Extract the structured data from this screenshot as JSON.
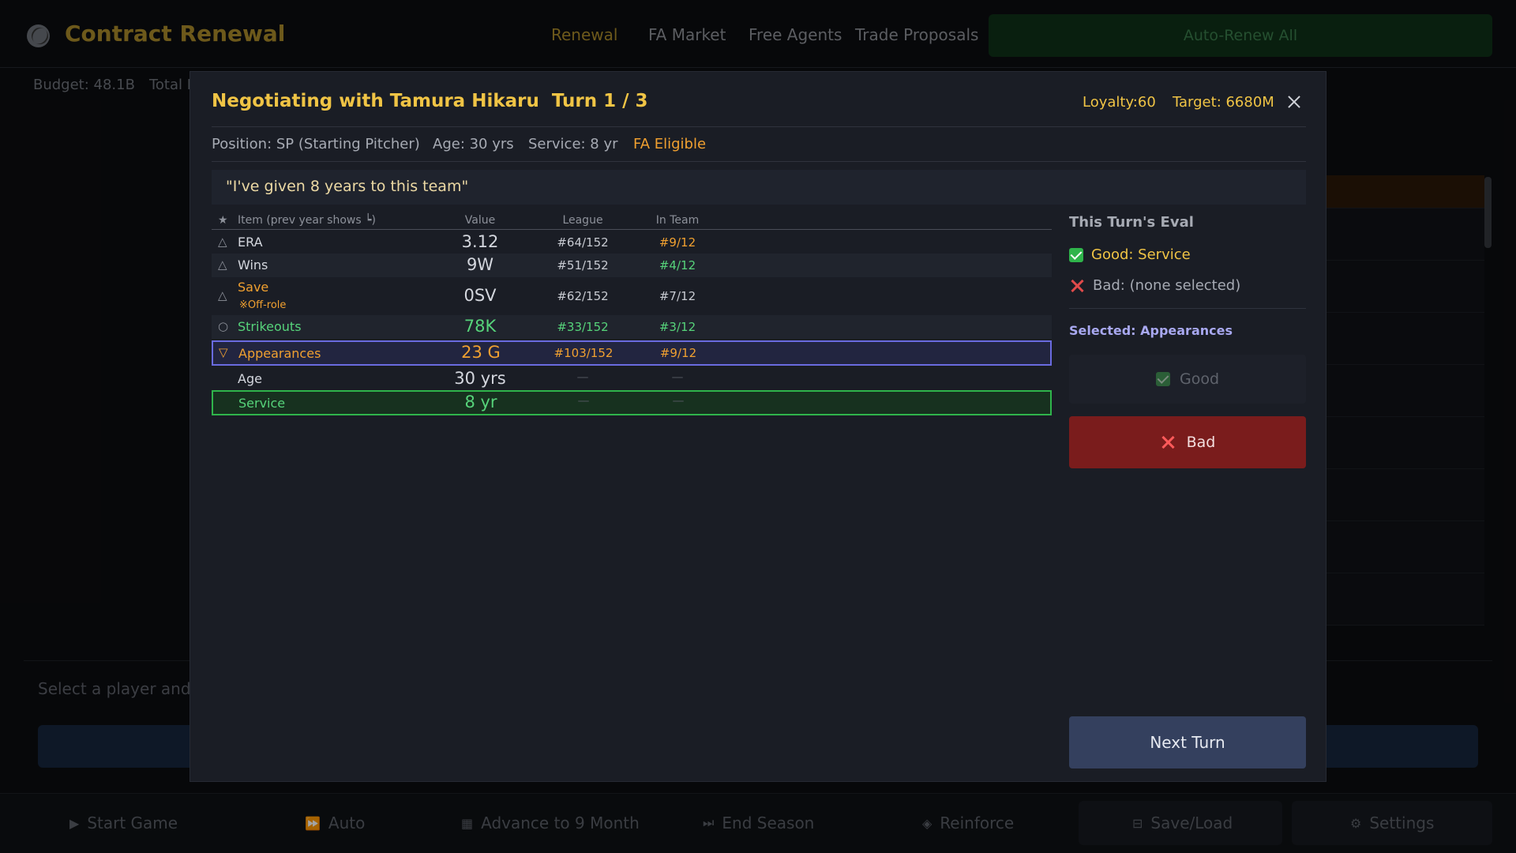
{
  "app": {
    "title": "Contract Renewal",
    "nav": [
      "Renewal",
      "FA Market",
      "Free Agents",
      "Trade Proposals"
    ],
    "auto_renew_label": "Auto-Renew All",
    "budget": "Budget: 48.1B",
    "total_label": "Total P",
    "hint": "Select a player and n",
    "bottom": {
      "start_game": "Start Game",
      "auto": "Auto",
      "advance": "Advance to 9 Month",
      "end_season": "End Season",
      "reinforce": "Reinforce",
      "save_load": "Save/Load",
      "settings": "Settings"
    }
  },
  "modal": {
    "title": "Negotiating with Tamura Hikaru  Turn 1 / 3",
    "loyalty": "Loyalty:60",
    "target": "Target: 6680M",
    "position": "Position: SP (Starting Pitcher)",
    "age": "Age: 30 yrs",
    "service": "Service: 8 yr",
    "fa_status": "FA Eligible",
    "quote": "\"I've given 8 years to this team\"",
    "table": {
      "headers": {
        "mark": "★",
        "item": "Item (prev year shows ┕)",
        "value": "Value",
        "league": "League",
        "team": "In Team"
      },
      "rows": [
        {
          "mark": "△",
          "name": "ERA",
          "value": "3.12",
          "league": "#64/152",
          "team": "#9/12"
        },
        {
          "mark": "△",
          "name": "Wins",
          "value": "9W",
          "league": "#51/152",
          "team": "#4/12"
        },
        {
          "mark": "△",
          "name": "Save",
          "sub": "※Off-role",
          "value": "0SV",
          "league": "#62/152",
          "team": "#7/12"
        },
        {
          "mark": "○",
          "name": "Strikeouts",
          "value": "78K",
          "league": "#33/152",
          "team": "#3/12"
        },
        {
          "mark": "▽",
          "name": "Appearances",
          "value": "23 G",
          "league": "#103/152",
          "team": "#9/12"
        },
        {
          "mark": "",
          "name": "Age",
          "value": "30 yrs",
          "league": "—",
          "team": "—"
        },
        {
          "mark": "",
          "name": "Service",
          "value": "8 yr",
          "league": "—",
          "team": "—"
        }
      ]
    },
    "eval": {
      "title": "This Turn's Eval",
      "good": "Good: Service",
      "bad": "Bad: (none selected)",
      "selected": "Selected: Appearances",
      "good_button": "Good",
      "bad_button": "Bad",
      "next_button": "Next Turn"
    }
  }
}
